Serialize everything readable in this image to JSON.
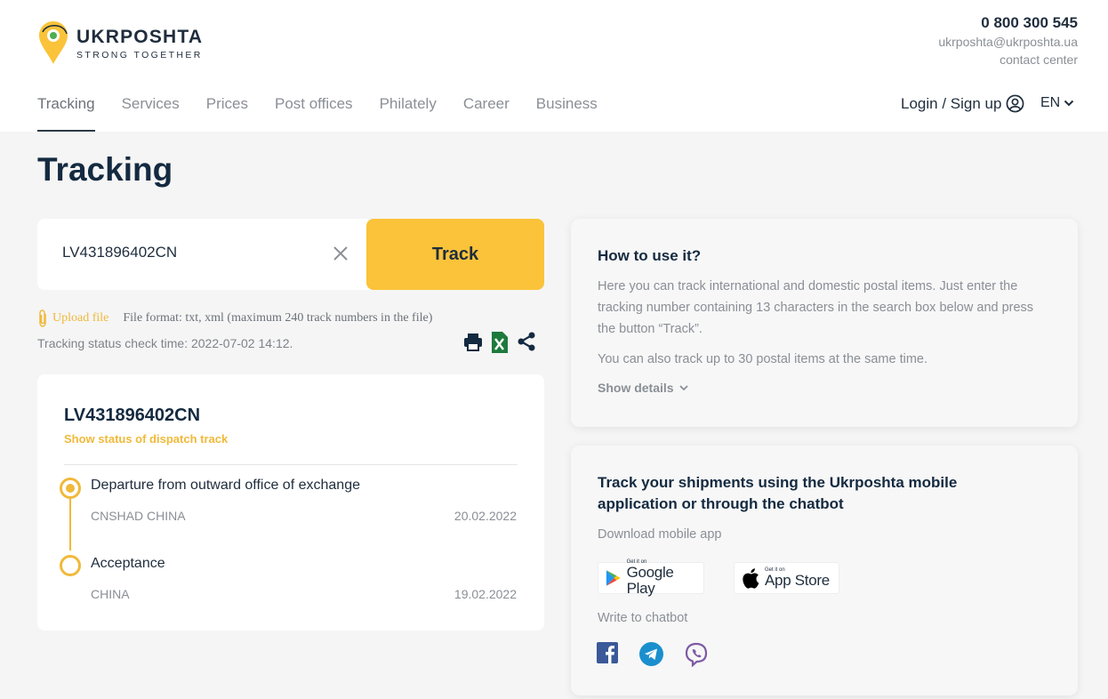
{
  "brand": {
    "name": "UKRPOSHTA",
    "tagline": "STRONG TOGETHER",
    "colors": {
      "accent": "#fbc33a",
      "dark": "#142a40"
    }
  },
  "contact": {
    "phone": "0 800 300 545",
    "email": "ukrposhta@ukrposhta.ua",
    "label": "contact center"
  },
  "nav": {
    "items": [
      {
        "label": "Tracking",
        "active": true
      },
      {
        "label": "Services"
      },
      {
        "label": "Prices"
      },
      {
        "label": "Post offices"
      },
      {
        "label": "Philately"
      },
      {
        "label": "Career"
      },
      {
        "label": "Business"
      }
    ],
    "login_label": "Login / Sign up",
    "language": "EN"
  },
  "page": {
    "title": "Tracking"
  },
  "search": {
    "value": "LV431896402CN",
    "button_label": "Track",
    "upload_label": "Upload file",
    "file_format": "File format: txt, xml (maximum 240 track numbers in the file)",
    "check_time": "Tracking status check time: 2022-07-02 14:12."
  },
  "actions": [
    "print-icon",
    "excel-icon",
    "share-icon"
  ],
  "result": {
    "number": "LV431896402CN",
    "dispatch_link": "Show status of dispatch track",
    "events": [
      {
        "title": "Departure from outward office of exchange",
        "place": "CNSHAD CHINA",
        "date": "20.02.2022",
        "current": true
      },
      {
        "title": "Acceptance",
        "place": "CHINA",
        "date": "19.02.2022",
        "current": false
      }
    ]
  },
  "how_to": {
    "title": "How to use it?",
    "text1": "Here you can track international and domestic postal items. Just enter the tracking number containing 13 characters in the search box below and press the button “Track”.",
    "text2": "You can also track up to 30 postal items at the same time.",
    "show_details": "Show details"
  },
  "app": {
    "title": "Track your shipments using the Ukrposhta mobile application or through the chatbot",
    "download_label": "Download mobile app",
    "google_small": "Get it on",
    "google_big": "Google Play",
    "apple_small": "Get it on",
    "apple_big": "App Store",
    "chatbot_label": "Write to chatbot",
    "chat_icons": [
      "facebook-icon",
      "telegram-icon",
      "viber-icon"
    ]
  }
}
